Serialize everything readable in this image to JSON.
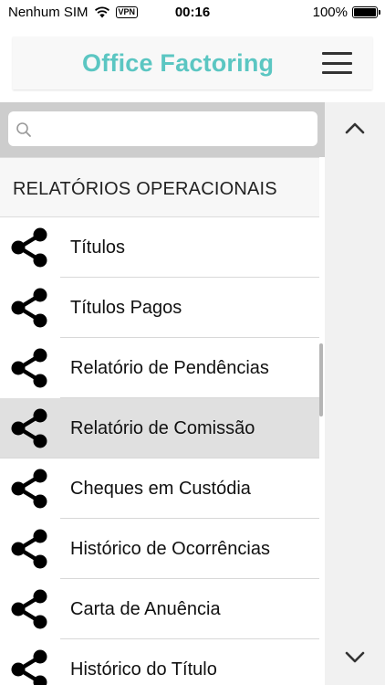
{
  "status_bar": {
    "carrier": "Nenhum SIM",
    "vpn": "VPN",
    "time": "00:16",
    "battery": "100%",
    "battery_level": 1.0
  },
  "header": {
    "title": "Office Factoring",
    "title_color": "#5bc6c2",
    "menu_icon": "hamburger-menu-icon"
  },
  "search": {
    "value": "",
    "placeholder": "",
    "icon": "search-icon"
  },
  "scroll": {
    "up_icon": "chevron-up-icon",
    "down_icon": "chevron-down-icon"
  },
  "section": {
    "title": "RELATÓRIOS OPERACIONAIS"
  },
  "menu": {
    "item_icon": "share-icon",
    "items": [
      {
        "label": "Títulos"
      },
      {
        "label": "Títulos Pagos"
      },
      {
        "label": "Relatório de Pendências"
      },
      {
        "label": "Relatório de Comissão",
        "selected": true
      },
      {
        "label": "Cheques em Custódia"
      },
      {
        "label": "Histórico de Ocorrências"
      },
      {
        "label": "Carta de Anuência"
      },
      {
        "label": "Histórico do Título"
      }
    ]
  }
}
